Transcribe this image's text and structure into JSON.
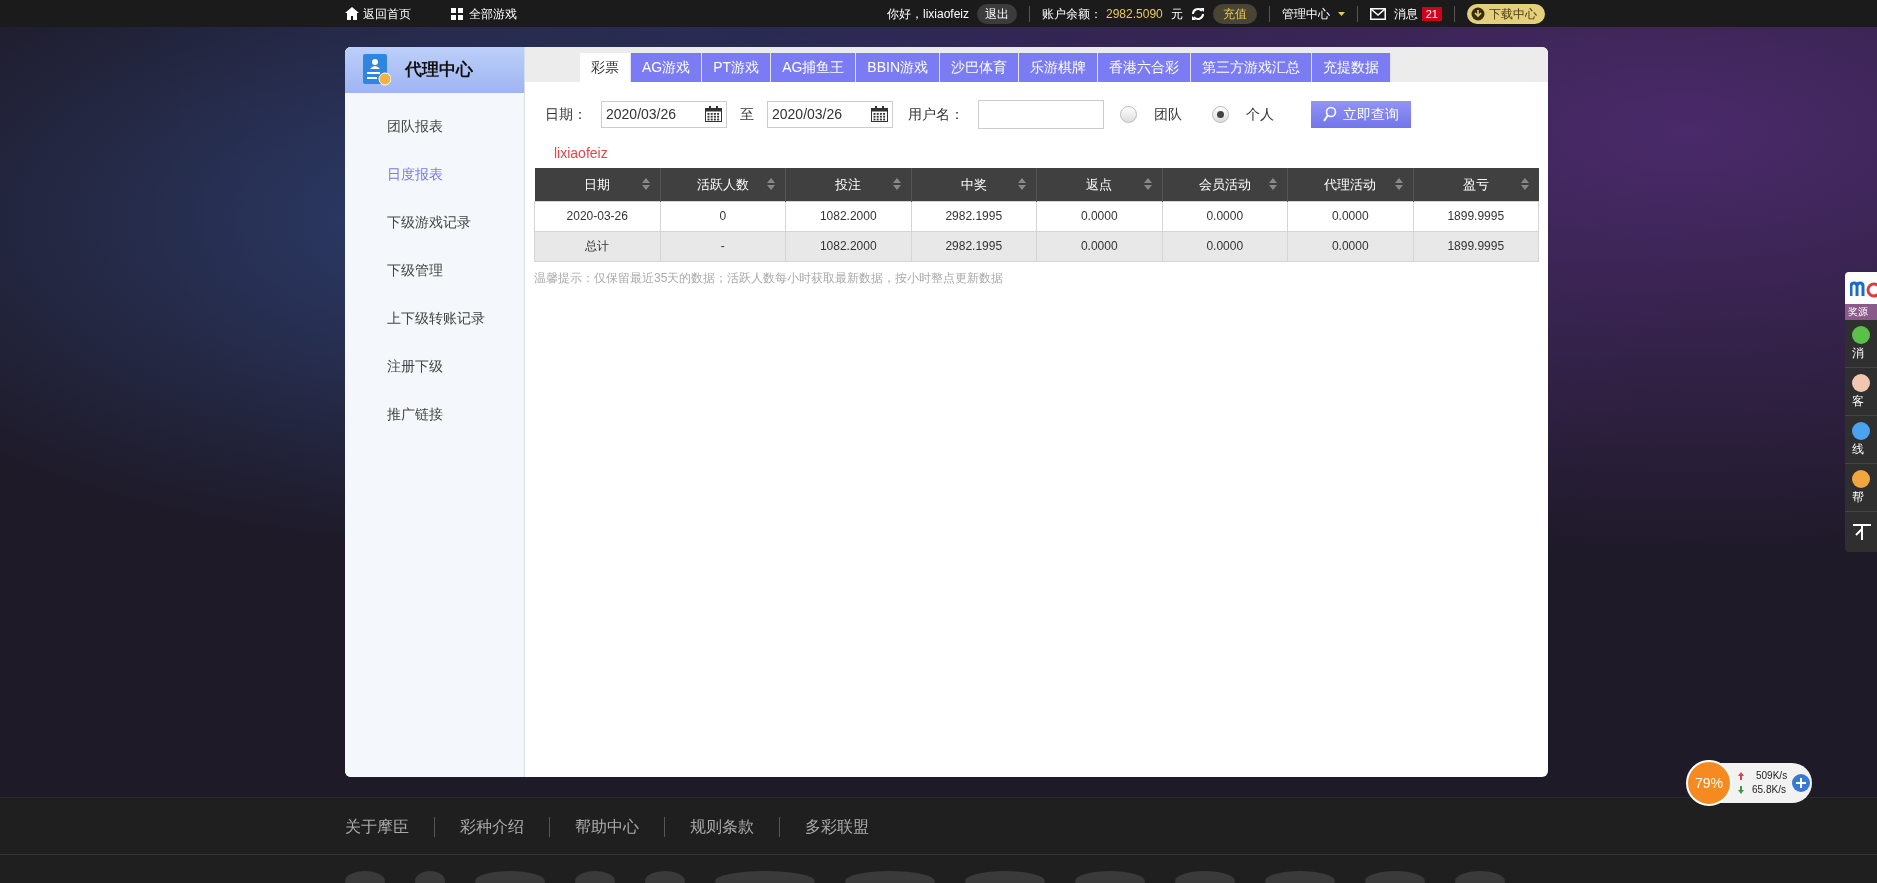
{
  "top_bar": {
    "home_link": "返回首页",
    "games_link": "全部游戏",
    "greeting": "你好，lixiaofeiz",
    "logout": "退出",
    "balance_label": "账户余额：",
    "balance": "2982.5090",
    "currency": "元",
    "recharge": "充值",
    "admin_menu": "管理中心",
    "messages": "消息",
    "message_count": "21",
    "download": "下载中心"
  },
  "sidebar": {
    "title": "代理中心",
    "items": [
      {
        "label": "团队报表",
        "selected": false
      },
      {
        "label": "日度报表",
        "selected": true
      },
      {
        "label": "下级游戏记录",
        "selected": false
      },
      {
        "label": "下级管理",
        "selected": false
      },
      {
        "label": "上下级转账记录",
        "selected": false
      },
      {
        "label": "注册下级",
        "selected": false
      },
      {
        "label": "推广链接",
        "selected": false
      }
    ]
  },
  "tabs": [
    {
      "label": "彩票",
      "selected": true
    },
    {
      "label": "AG游戏",
      "selected": false
    },
    {
      "label": "PT游戏",
      "selected": false
    },
    {
      "label": "AG捕鱼王",
      "selected": false
    },
    {
      "label": "BBIN游戏",
      "selected": false
    },
    {
      "label": "沙巴体育",
      "selected": false
    },
    {
      "label": "乐游棋牌",
      "selected": false
    },
    {
      "label": "香港六合彩",
      "selected": false
    },
    {
      "label": "第三方游戏汇总",
      "selected": false
    },
    {
      "label": "充提数据",
      "selected": false
    }
  ],
  "filter": {
    "date_label": "日期：",
    "date_from": "2020/03/26",
    "to_label": "至",
    "date_to": "2020/03/26",
    "username_label": "用户名：",
    "scope": [
      {
        "label": "团队",
        "selected": false
      },
      {
        "label": "个人",
        "selected": true
      }
    ],
    "search_button": "立即查询"
  },
  "current_user": "lixiaofeiz",
  "table": {
    "columns": [
      "日期",
      "活跃人数",
      "投注",
      "中奖",
      "返点",
      "会员活动",
      "代理活动",
      "盈亏"
    ],
    "rows": [
      {
        "kind": "data",
        "cells": [
          "2020-03-26",
          "0",
          "1082.2000",
          "2982.1995",
          "0.0000",
          "0.0000",
          "0.0000",
          "1899.9995"
        ]
      },
      {
        "kind": "total",
        "cells": [
          "总计",
          "-",
          "1082.2000",
          "2982.1995",
          "0.0000",
          "0.0000",
          "0.0000",
          "1899.9995"
        ]
      }
    ]
  },
  "note": "温馨提示：仅保留最近35天的数据；活跃人数每小时获取最新数据，按小时整点更新数据",
  "side_widget": {
    "header": "奖源",
    "items": [
      "消",
      "客",
      "线",
      "帮"
    ]
  },
  "net_monitor": {
    "percent": "79%",
    "upload": "509K/s",
    "download": "65.8K/s"
  },
  "footer": {
    "links": [
      "关于摩臣",
      "彩种介绍",
      "帮助中心",
      "规则条款",
      "多彩联盟"
    ]
  }
}
